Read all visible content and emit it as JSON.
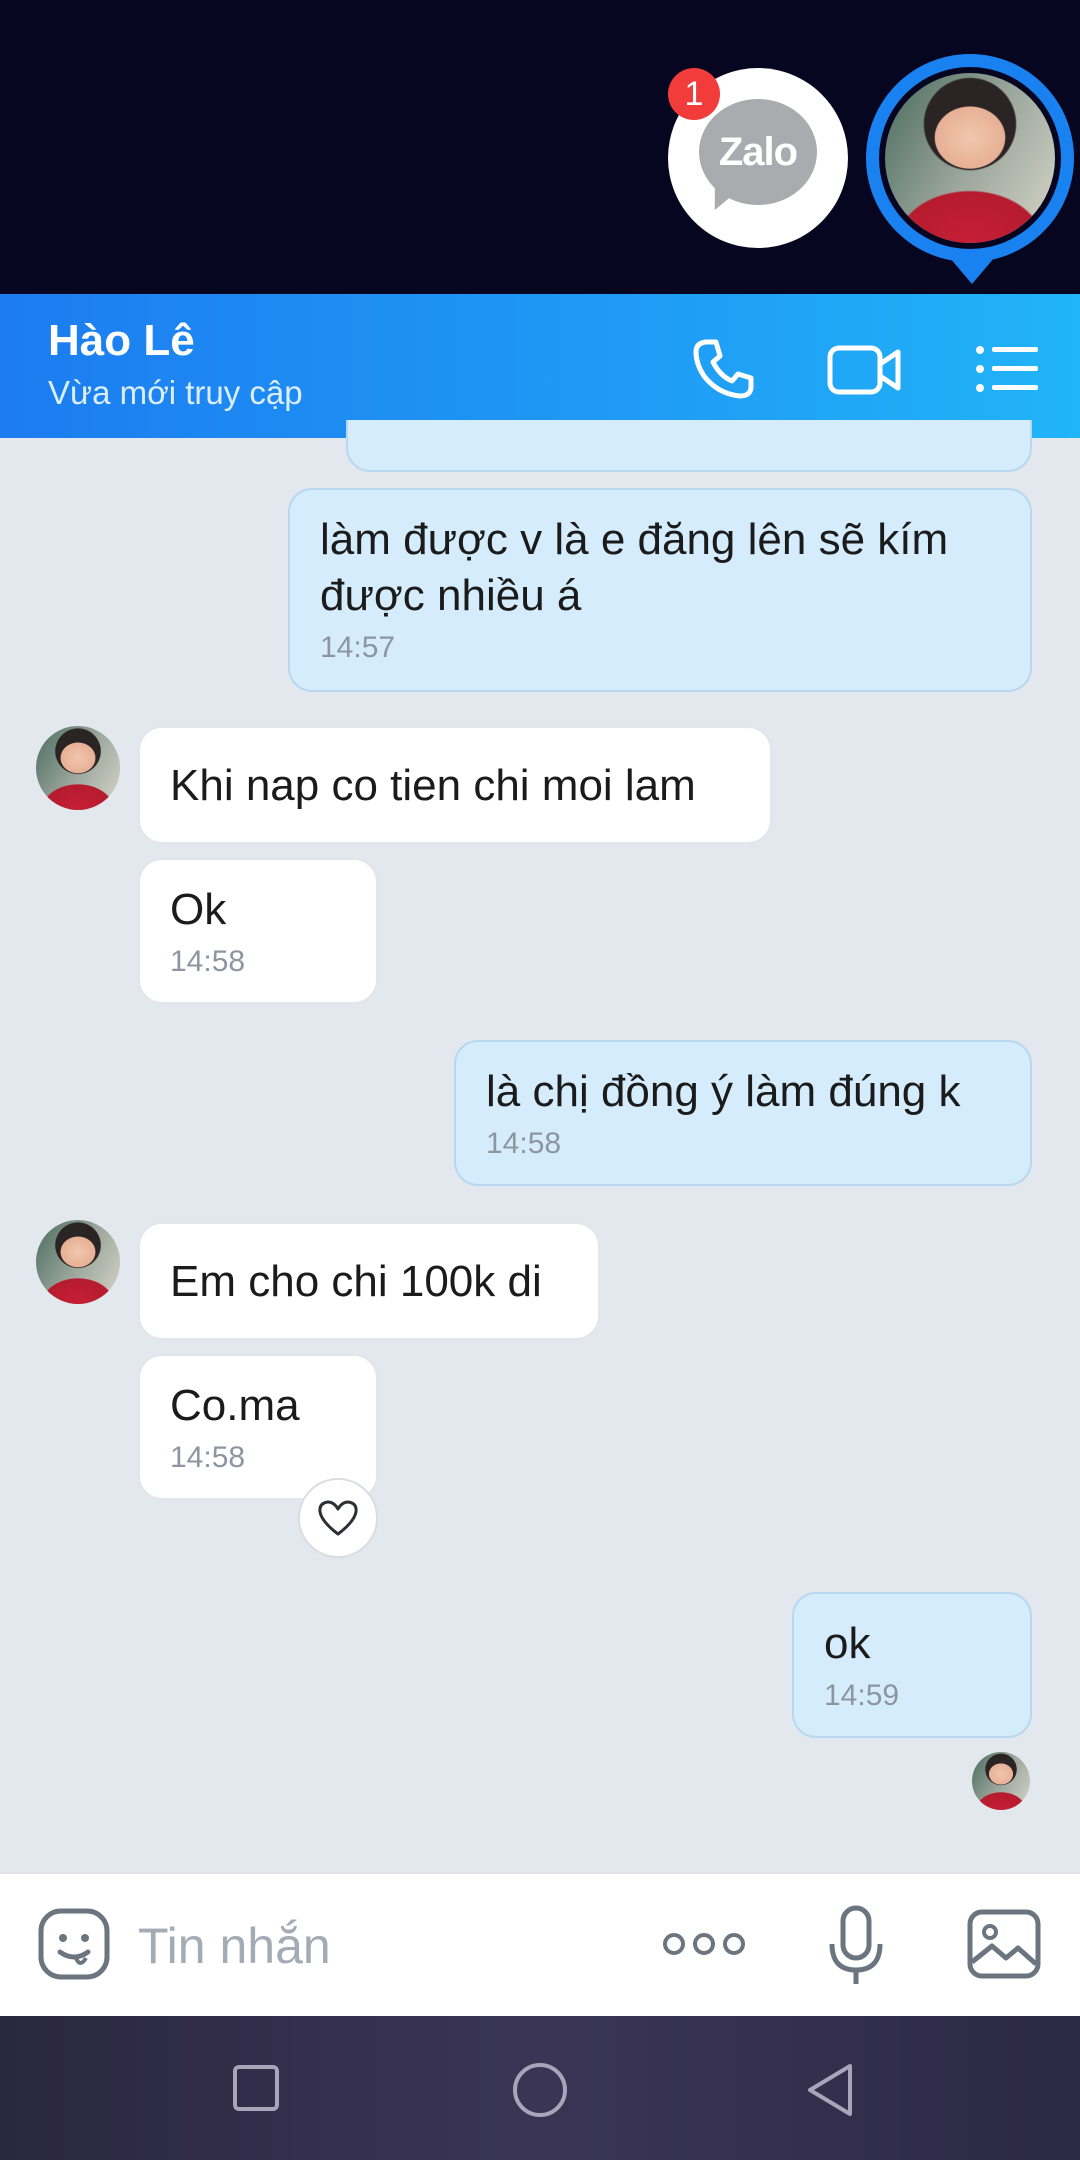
{
  "overlay": {
    "app_label": "Zalo",
    "notification_count": "1"
  },
  "header": {
    "contact_name": "Hào Lê",
    "status": "Vừa mới truy cập"
  },
  "messages": [
    {
      "side": "sent",
      "text": "làm được v là e đăng lên sẽ kím được nhiều á",
      "time": "14:57"
    },
    {
      "side": "received",
      "text": "Khi nap co tien chi moi lam",
      "time": ""
    },
    {
      "side": "received",
      "text": "Ok",
      "time": "14:58"
    },
    {
      "side": "sent",
      "text": "là chị đồng ý làm đúng k",
      "time": "14:58"
    },
    {
      "side": "received",
      "text": "Em cho chi 100k di",
      "time": ""
    },
    {
      "side": "received",
      "text": "Co.ma",
      "time": "14:58"
    },
    {
      "side": "sent",
      "text": "ok",
      "time": "14:59"
    }
  ],
  "composer": {
    "placeholder": "Tin nhắn"
  },
  "colors": {
    "header_gradient_start": "#1c7cf0",
    "header_gradient_end": "#21b4f7",
    "sent_bubble": "#d5ecfc",
    "received_bubble": "#ffffff",
    "chat_background": "#e3e8ef",
    "badge": "#f23b3b"
  },
  "icons": {
    "header": [
      "phone-icon",
      "video-call-icon",
      "menu-list-icon"
    ],
    "composer": [
      "sticker-icon",
      "more-icon",
      "microphone-icon",
      "image-icon"
    ],
    "navigation": [
      "recent-apps-icon",
      "home-icon",
      "back-icon"
    ]
  }
}
